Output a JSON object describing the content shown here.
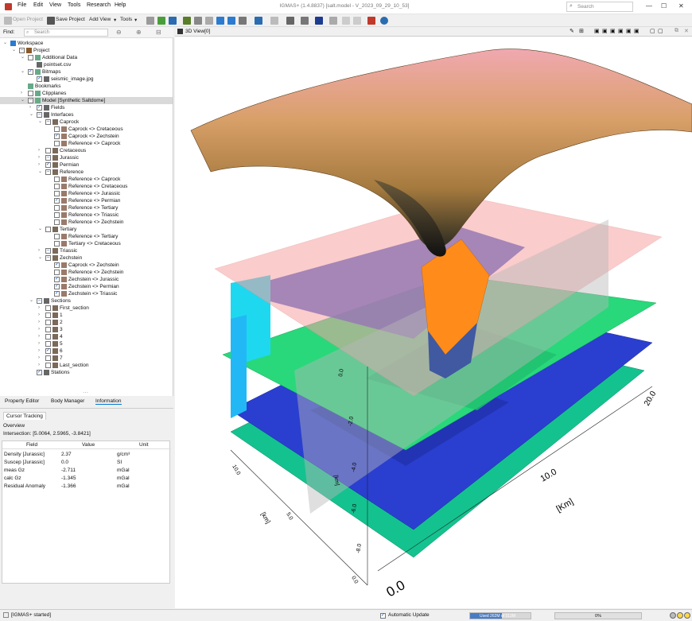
{
  "menu": [
    "File",
    "Edit",
    "View",
    "Tools",
    "Research",
    "Help"
  ],
  "window_title": "IGMAS+ (1.4.8837) [salt.model - V_2023_09_29_10_53]",
  "search_placeholder": "Search",
  "toolbar": {
    "open_project": "Open Project",
    "save_project": "Save Project",
    "add_view": "Add View",
    "tools": "Tools"
  },
  "find": {
    "label": "Find:",
    "placeholder": "Search"
  },
  "tree": [
    {
      "label": "Workspace",
      "level": 0,
      "check": null,
      "expand": "v"
    },
    {
      "label": "Project",
      "level": 1,
      "check": "partial",
      "expand": "v"
    },
    {
      "label": "Additional Data",
      "level": 2,
      "check": "off",
      "expand": "v"
    },
    {
      "label": "pointset.csv",
      "level": 3,
      "check": null,
      "expand": ""
    },
    {
      "label": "Bitmaps",
      "level": 2,
      "check": "on",
      "expand": "v"
    },
    {
      "label": "seismic_image.jpg",
      "level": 3,
      "check": "on",
      "expand": ""
    },
    {
      "label": "Bookmarks",
      "level": 2,
      "check": null,
      "expand": ""
    },
    {
      "label": "Clipplanes",
      "level": 2,
      "check": "off",
      "expand": ">"
    },
    {
      "label": "Model [Synthetic Saltdome]",
      "level": 2,
      "check": "partial",
      "expand": "v",
      "selected": true
    },
    {
      "label": "Fields",
      "level": 3,
      "check": "on",
      "expand": ">"
    },
    {
      "label": "Interfaces",
      "level": 3,
      "check": "partial",
      "expand": "v"
    },
    {
      "label": "Caprock",
      "level": 4,
      "check": "partial",
      "expand": "v"
    },
    {
      "label": "Caprock <> Cretaceous",
      "level": 5,
      "check": "off",
      "expand": ""
    },
    {
      "label": "Caprock <> Zechstein",
      "level": 5,
      "check": "on",
      "expand": ""
    },
    {
      "label": "Reference <> Caprock",
      "level": 5,
      "check": "off",
      "expand": ""
    },
    {
      "label": "Cretaceous",
      "level": 4,
      "check": "off",
      "expand": ">"
    },
    {
      "label": "Jurassic",
      "level": 4,
      "check": "partial",
      "expand": ">"
    },
    {
      "label": "Permian",
      "level": 4,
      "check": "on",
      "expand": ">"
    },
    {
      "label": "Reference",
      "level": 4,
      "check": "partial",
      "expand": "v"
    },
    {
      "label": "Reference <> Caprock",
      "level": 5,
      "check": "off",
      "expand": ""
    },
    {
      "label": "Reference <> Cretaceous",
      "level": 5,
      "check": "off",
      "expand": ""
    },
    {
      "label": "Reference <> Jurassic",
      "level": 5,
      "check": "off",
      "expand": ""
    },
    {
      "label": "Reference <> Permian",
      "level": 5,
      "check": "on",
      "expand": ""
    },
    {
      "label": "Reference <> Tertiary",
      "level": 5,
      "check": "off",
      "expand": ""
    },
    {
      "label": "Reference <> Triassic",
      "level": 5,
      "check": "off",
      "expand": ""
    },
    {
      "label": "Reference <> Zechstein",
      "level": 5,
      "check": "off",
      "expand": ""
    },
    {
      "label": "Tertiary",
      "level": 4,
      "check": "off",
      "expand": "v"
    },
    {
      "label": "Reference <> Tertiary",
      "level": 5,
      "check": "off",
      "expand": ""
    },
    {
      "label": "Tertiary <> Cretaceous",
      "level": 5,
      "check": "off",
      "expand": ""
    },
    {
      "label": "Triassic",
      "level": 4,
      "check": "partial",
      "expand": ">"
    },
    {
      "label": "Zechstein",
      "level": 4,
      "check": "partial",
      "expand": "v"
    },
    {
      "label": "Caprock <> Zechstein",
      "level": 5,
      "check": "on",
      "expand": ""
    },
    {
      "label": "Reference <> Zechstein",
      "level": 5,
      "check": "off",
      "expand": ""
    },
    {
      "label": "Zechstein <> Jurassic",
      "level": 5,
      "check": "on",
      "expand": ""
    },
    {
      "label": "Zechstein <> Permian",
      "level": 5,
      "check": "on",
      "expand": ""
    },
    {
      "label": "Zechstein <> Triassic",
      "level": 5,
      "check": "on",
      "expand": ""
    },
    {
      "label": "Sections",
      "level": 3,
      "check": "partial",
      "expand": "v"
    },
    {
      "label": "First_section",
      "level": 4,
      "check": "off",
      "expand": ">"
    },
    {
      "label": "1",
      "level": 4,
      "check": "off",
      "expand": ">"
    },
    {
      "label": "2",
      "level": 4,
      "check": "off",
      "expand": ">"
    },
    {
      "label": "3",
      "level": 4,
      "check": "off",
      "expand": ">"
    },
    {
      "label": "4",
      "level": 4,
      "check": "off",
      "expand": ">"
    },
    {
      "label": "5",
      "level": 4,
      "check": "off",
      "expand": ">"
    },
    {
      "label": "6",
      "level": 4,
      "check": "on",
      "expand": ">"
    },
    {
      "label": "7",
      "level": 4,
      "check": "off",
      "expand": ">"
    },
    {
      "label": "Last_section",
      "level": 4,
      "check": "off",
      "expand": ">"
    },
    {
      "label": "Stations",
      "level": 3,
      "check": "on",
      "expand": ""
    }
  ],
  "bottom_tabs": [
    "Property Editor",
    "Body Manager",
    "Information"
  ],
  "cursor_tab": "Cursor Tracking",
  "overview": "Overview",
  "intersection": "Intersection: [5.0064, 2.5965, -3.8421]",
  "props_headers": [
    "Field",
    "Value",
    "Unit"
  ],
  "props_rows": [
    {
      "field": "Density [Jurassic]",
      "value": "2.37",
      "unit": "g/cm³"
    },
    {
      "field": "Suscep [Jurassic]",
      "value": "0.0",
      "unit": "SI"
    },
    {
      "field": "meas Gz",
      "value": "-2.711",
      "unit": "mGal"
    },
    {
      "field": "calc Gz",
      "value": "-1.345",
      "unit": "mGal"
    },
    {
      "field": "Residual Anomaly",
      "value": "-1.366",
      "unit": "mGal"
    }
  ],
  "view_tab": "3D View[0]",
  "axis_labels": {
    "x_ticks": [
      "0.0",
      "10.0",
      "20.0"
    ],
    "x_unit": "[Km]",
    "y_ticks": [
      "10.0",
      "5.0",
      "0.0"
    ],
    "y_unit": "[km]",
    "z_ticks": [
      "0.0",
      "-2.0",
      "-4.0",
      "-6.0",
      "-8.0"
    ],
    "z_unit": "[km]"
  },
  "status": {
    "message": "[IGMAS+ started]",
    "auto_update": "Automatic Update",
    "memory": "Used 262M of 512M",
    "progress": "0%"
  },
  "colors": {
    "accent": "#0078d4",
    "surface_top": "#c78a4a",
    "layer_green": "#2ecc71",
    "layer_blue": "#2845c8",
    "layer_teal": "#16b89a",
    "salt_orange": "#ff8c1a",
    "plane_pink": "#f7a3a3"
  }
}
